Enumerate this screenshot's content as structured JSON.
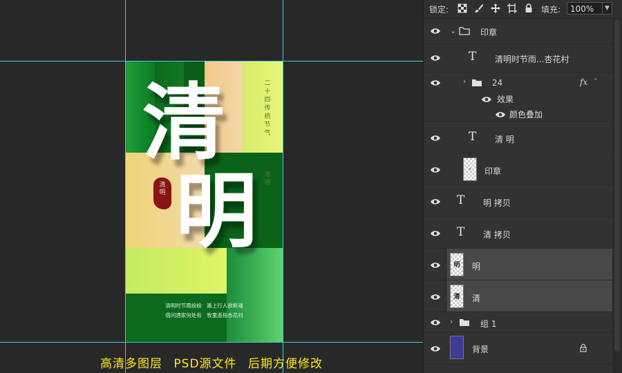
{
  "poster": {
    "big_char_1": "清",
    "big_char_2": "明",
    "vertical_text": "二十四传统节气",
    "vertical_text_2": "清明",
    "seal_text": "清明",
    "poem_line_1": "清明时节雨纷纷　路上行人欲断魂",
    "poem_line_2": "借问酒家何处有　牧童遥指杏花村"
  },
  "caption": {
    "part_1": "高清多图层",
    "part_2": "PSD源文件",
    "part_3": "后期方便修改"
  },
  "toolbar": {
    "lock_label": "锁定:",
    "fill_label": "填充:",
    "fill_value": "100%",
    "icons": [
      "lock-transparent-pixels-icon",
      "lock-image-pixels-icon",
      "lock-position-icon",
      "lock-artboard-icon",
      "lock-all-icon"
    ]
  },
  "layers": [
    {
      "name": "印章",
      "kind": "group-open"
    },
    {
      "name": "清明时节雨...杏花村",
      "kind": "text"
    },
    {
      "name": "24",
      "kind": "group-closed",
      "fx": "fx",
      "effects_label": "效果",
      "effect_name": "颜色叠加"
    },
    {
      "name": "清 明",
      "kind": "text"
    },
    {
      "name": "印章",
      "kind": "image"
    },
    {
      "name": "明 拷贝",
      "kind": "text"
    },
    {
      "name": "清 拷贝",
      "kind": "text"
    },
    {
      "name": "明",
      "kind": "image",
      "thumb_char": "明",
      "selected": true
    },
    {
      "name": "清",
      "kind": "image",
      "thumb_char": "清",
      "selected": true
    },
    {
      "name": "组 1",
      "kind": "group-closed"
    },
    {
      "name": "背景",
      "kind": "background",
      "color": "#3f3a9a"
    }
  ],
  "colors": {
    "guide": "#3ad0e0",
    "caption": "#ffe71f",
    "seal": "#8a1414"
  }
}
